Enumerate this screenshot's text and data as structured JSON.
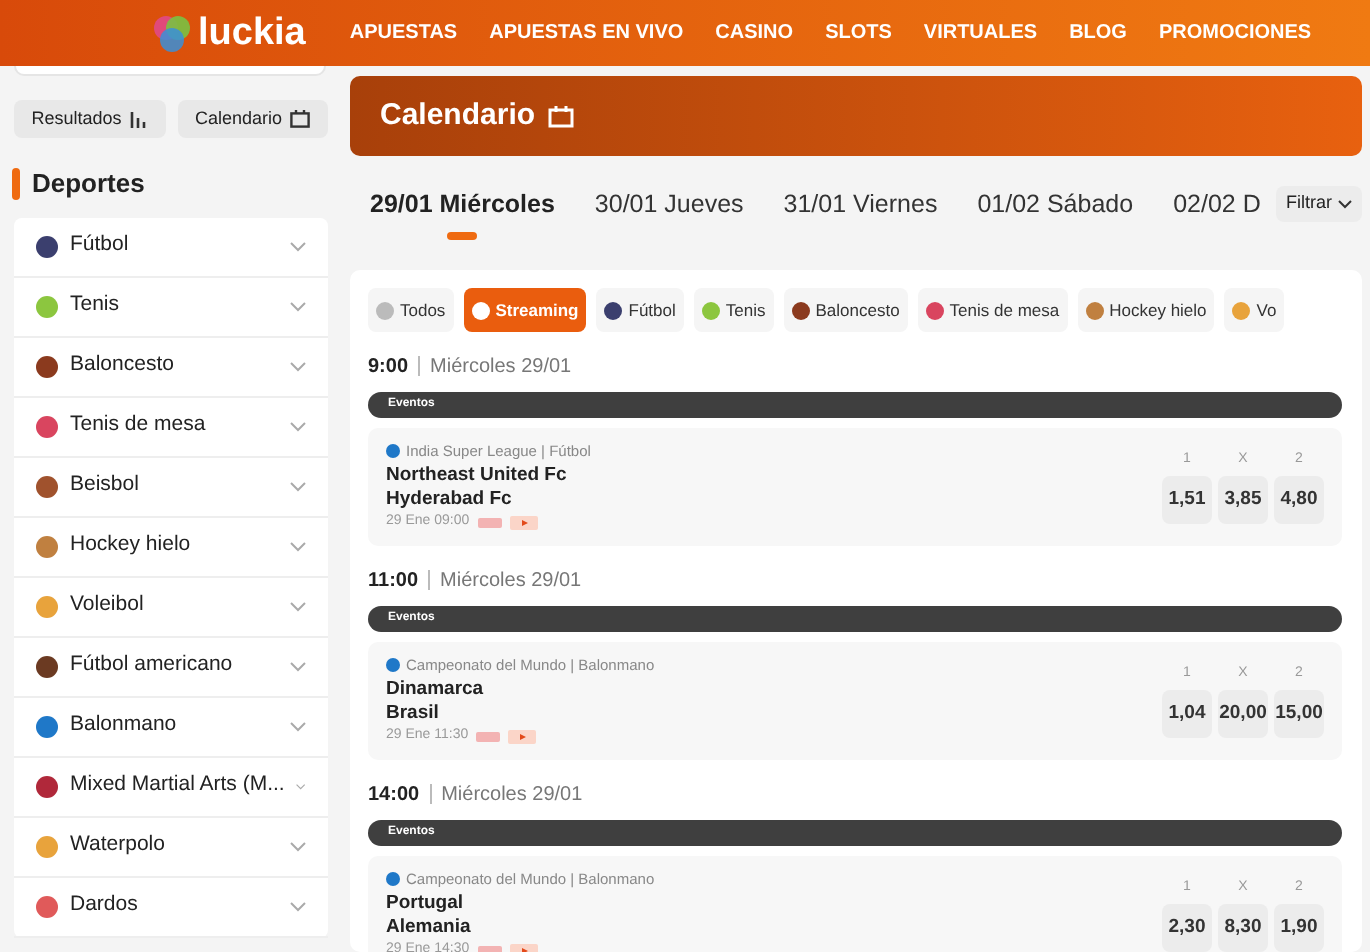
{
  "header": {
    "logo": "luckia",
    "nav": [
      {
        "label": "APUESTAS"
      },
      {
        "label": "APUESTAS EN VIVO"
      },
      {
        "label": "CASINO"
      },
      {
        "label": "SLOTS"
      },
      {
        "label": "VIRTUALES"
      },
      {
        "label": "BLOG"
      },
      {
        "label": "PROMOCIONES"
      }
    ]
  },
  "sidebar": {
    "buttons": [
      {
        "label": "Resultados",
        "kind": "chart"
      },
      {
        "label": "Calendario",
        "kind": "calendar"
      }
    ],
    "title": "Deportes",
    "items": [
      {
        "label": "Fútbol",
        "color": "#3b3f6e"
      },
      {
        "label": "Tenis",
        "color": "#8cc63f"
      },
      {
        "label": "Baloncesto",
        "color": "#8b3a1e"
      },
      {
        "label": "Tenis de mesa",
        "color": "#d9455f"
      },
      {
        "label": "Beisbol",
        "color": "#a0522d"
      },
      {
        "label": "Hockey hielo",
        "color": "#c08040"
      },
      {
        "label": "Voleibol",
        "color": "#e8a33c"
      },
      {
        "label": "Fútbol americano",
        "color": "#6b3a22"
      },
      {
        "label": "Balonmano",
        "color": "#1f78c8"
      },
      {
        "label": "Mixed Martial Arts (M...",
        "color": "#b0283a"
      },
      {
        "label": "Waterpolo",
        "color": "#e8a33c"
      },
      {
        "label": "Dardos",
        "color": "#e05a5a"
      }
    ]
  },
  "banner": {
    "title": "Calendario"
  },
  "dates": [
    {
      "label": "29/01 Miércoles",
      "selected": true
    },
    {
      "label": "30/01 Jueves",
      "selected": false
    },
    {
      "label": "31/01 Viernes",
      "selected": false
    },
    {
      "label": "01/02 Sábado",
      "selected": false
    },
    {
      "label": "02/02 D",
      "selected": false
    }
  ],
  "filter": {
    "label": "Filtrar"
  },
  "chips": [
    {
      "label": "Todos",
      "selected": false,
      "color": "#bbbbbb"
    },
    {
      "label": "Streaming",
      "selected": true,
      "color": "#ffffff"
    },
    {
      "label": "Fútbol",
      "selected": false,
      "color": "#3b3f6e"
    },
    {
      "label": "Tenis",
      "selected": false,
      "color": "#8cc63f"
    },
    {
      "label": "Baloncesto",
      "selected": false,
      "color": "#8b3a1e"
    },
    {
      "label": "Tenis de mesa",
      "selected": false,
      "color": "#d9455f"
    },
    {
      "label": "Hockey hielo",
      "selected": false,
      "color": "#c08040"
    },
    {
      "label": "Vo",
      "selected": false,
      "color": "#e8a33c"
    }
  ],
  "sections": [
    {
      "time": "9:00",
      "date": "Miércoles 29/01",
      "bar": "Eventos",
      "event": {
        "league": "India Super League | Fútbol",
        "home": "Northeast United Fc",
        "away": "Hyderabad Fc",
        "start": "29 Ene 09:00",
        "odds": [
          {
            "label": "1",
            "value": "1,51"
          },
          {
            "label": "X",
            "value": "3,85"
          },
          {
            "label": "2",
            "value": "4,80"
          }
        ]
      }
    },
    {
      "time": "11:00",
      "date": "Miércoles 29/01",
      "bar": "Eventos",
      "event": {
        "league": "Campeonato del Mundo | Balonmano",
        "home": "Dinamarca",
        "away": "Brasil",
        "start": "29 Ene 11:30",
        "odds": [
          {
            "label": "1",
            "value": "1,04"
          },
          {
            "label": "X",
            "value": "20,00"
          },
          {
            "label": "2",
            "value": "15,00"
          }
        ]
      }
    },
    {
      "time": "14:00",
      "date": "Miércoles 29/01",
      "bar": "Eventos",
      "event": {
        "league": "Campeonato del Mundo | Balonmano",
        "home": "Portugal",
        "away": "Alemania",
        "start": "29 Ene 14:30",
        "odds": [
          {
            "label": "1",
            "value": "2,30"
          },
          {
            "label": "X",
            "value": "8,30"
          },
          {
            "label": "2",
            "value": "1,90"
          }
        ]
      }
    }
  ]
}
